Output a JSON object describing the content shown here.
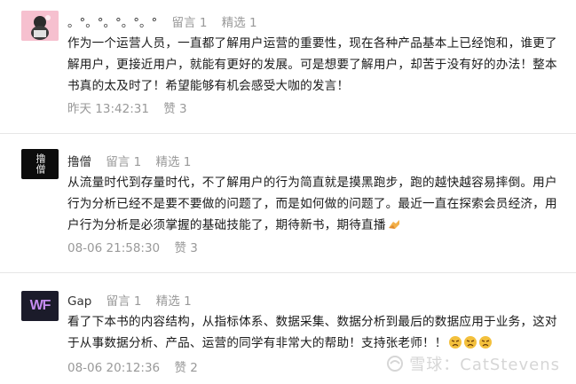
{
  "comments": [
    {
      "username": "。°。°。°。°。°",
      "replies_label": "留言 1",
      "featured_label": "精选 1",
      "text": "作为一个运营人员，一直都了解用户运营的重要性，现在各种产品基本上已经饱和，谁更了解用户，更接近用户，就能有更好的发展。可是想要了解用户，却苦于没有好的办法！整本书真的太及时了！希望能够有机会感受大咖的发言！",
      "time": "昨天 13:42:31",
      "likes_label": "赞 3"
    },
    {
      "username": "撸僧",
      "avatar_text": "撸僧",
      "replies_label": "留言 1",
      "featured_label": "精选 1",
      "text": "从流量时代到存量时代，不了解用户的行为简直就是摸黑跑步，跑的越快越容易摔倒。用户行为分析已经不是要不要做的问题了，而是如何做的问题了。最近一直在探索会员经济，用户行为分析是必须掌握的基础技能了，期待新书，期待直播",
      "time": "08-06 21:58:30",
      "likes_label": "赞 3"
    },
    {
      "username": "Gap",
      "avatar_text": "WF",
      "replies_label": "留言 1",
      "featured_label": "精选 1",
      "text": "看了下本书的内容结构，从指标体系、数据采集、数据分析到最后的数据应用于业务，这对于从事数据分析、产品、运营的同学有非常大的帮助！支持张老师！！",
      "time": "08-06 20:12:36",
      "likes_label": "赞 2"
    }
  ],
  "watermark": "雪球：CatStevens",
  "colors": {
    "meta": "#999999",
    "divider": "#e6e6e6",
    "avatar1_bg": "#f4b6c8"
  }
}
